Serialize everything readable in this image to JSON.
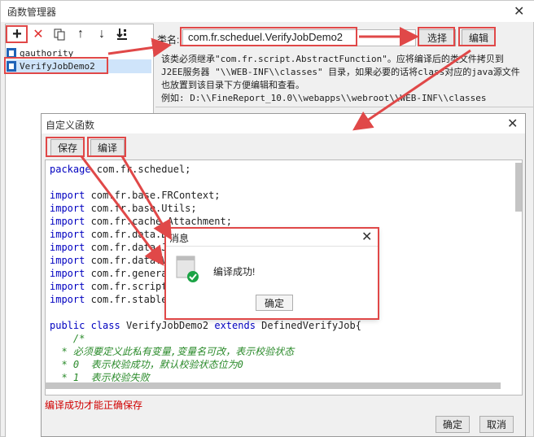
{
  "outer_window": {
    "title": "函数管理器",
    "close_symbol": "✕"
  },
  "toolbar": {
    "add": "+",
    "delete": "✕",
    "copy": "copy-icon",
    "up": "↑",
    "down": "↓",
    "bottom": "bottom-icon"
  },
  "function_list": {
    "items": [
      {
        "label": "gauthority"
      },
      {
        "label": "VerifyJobDemo2"
      }
    ]
  },
  "class_field": {
    "label": "类名:",
    "value": "com.fr.scheduel.VerifyJobDemo2",
    "choose_label": "选择",
    "edit_label": "编辑"
  },
  "hint_lines": [
    "该类必须继承\"com.fr.script.AbstractFunction\"。应将编译后的类文件拷贝到",
    "J2EE服务器 \"\\\\WEB-INF\\\\classes\" 目录，如果必要的话将class对应的java源文件",
    "也放置到该目录下方便编辑和查看。",
    "例如: D:\\\\FineReport_10.0\\\\webapps\\\\webroot\\\\WEB-INF\\\\classes"
  ],
  "dialog": {
    "title": "自定义函数",
    "close_symbol": "✕",
    "save_label": "保存",
    "compile_label": "编译",
    "compile_note": "编译成功才能正确保存",
    "ok_label": "确定",
    "cancel_label": "取消"
  },
  "code": {
    "package_kw": "package",
    "package_rest": " com.fr.scheduel;",
    "import_kw": "import",
    "imports": [
      " com.fr.base.FRContext;",
      " com.fr.base.Utils;",
      " com.fr.cache.Attachment;",
      " com.fr.data.D",
      " com.fr.data.J",
      " com.fr.data.V",
      " com.fr.genera",
      " com.fr.script",
      " com.fr.stable"
    ],
    "class_public": "public",
    "class_kw": "class",
    "class_name": "VerifyJobDemo2",
    "extends_kw": "extends",
    "extends_name": "DefinedVerifyJob{",
    "comment_lines": [
      "    /*",
      "  * 必须要定义此私有变量,变量名可改，表示校验状态",
      "  * 0  表示校验成功，默认校验状态位为0",
      "  * 1  表示校验失败"
    ]
  },
  "message_box": {
    "title": "消息",
    "close_symbol": "✕",
    "text": "编译成功!",
    "ok_label": "确定"
  },
  "colors": {
    "annotation": "#e04848",
    "keyword": "#0000c0",
    "comment": "#2a8a2a",
    "selection": "#cfe4fa",
    "success_green": "#1ba345",
    "note_red": "#d00000"
  }
}
